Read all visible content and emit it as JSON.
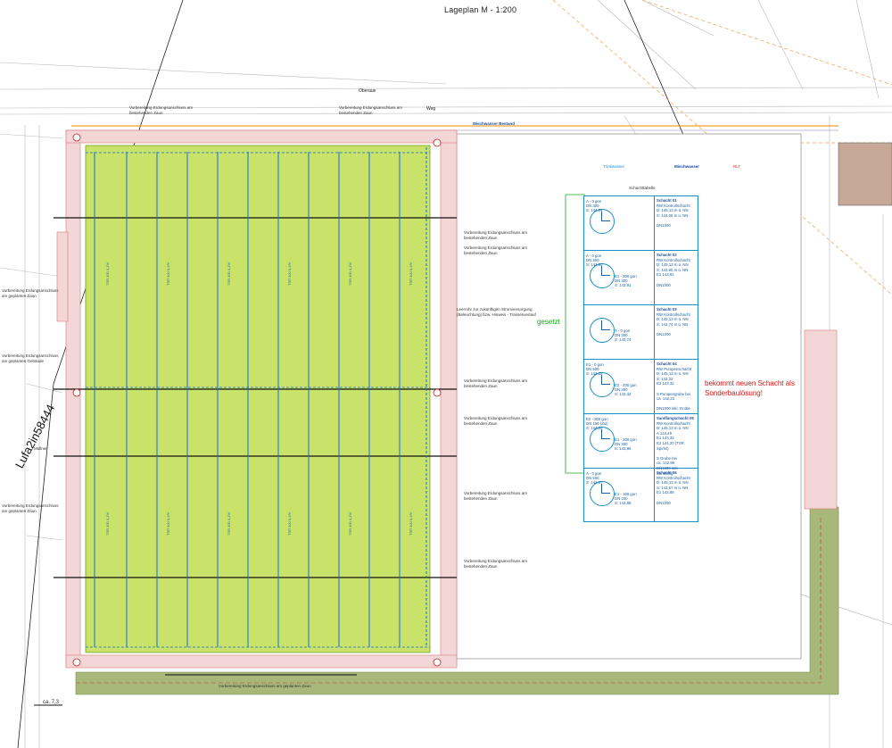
{
  "title": "Lageplan M - 1:200",
  "streets": {
    "upper": "Oberaue",
    "lower": "Weg"
  },
  "side_id": "Lufa2in58444",
  "labels": {
    "gesetzt": "gesetzt",
    "red_note": "bekommt neuen Schacht als Sonderbaulösung!",
    "rw_bestand": "Mischwasser Bestand",
    "regenwasser": "Trinkwasser",
    "mischwasser": "Mischwasser",
    "rlt": "RLT",
    "muellner": "Müllner",
    "dim": "ca. 7,3",
    "schaechte_title": "Schachttabelle"
  },
  "notes": {
    "top_left": "Vorbereitung Erdungsanschluss am bestehenden Zaun",
    "top_mid": "Vorbereitung Erdungsanschluss am bestehenden Zaun",
    "left_1": "Vorbereitung Erdungsanschluss am geplanten Zaun",
    "left_2": "Vorbereitung Erdungsanschluss am geplanten Gebäude",
    "left_3": "Vorbereitung Erdungsanschluss am geplanten Zaun",
    "right_1": "Vorbereitung Erdungsanschluss am bestehenden Zaun",
    "right_2": "Vorbereitung Erdungsanschluss am bestehenden Zaun",
    "right_3": "Leerrohr zur zukünftigen Stromversorgung (Beleuchtung) bzw. Hinweis - Trassenverlauf",
    "right_4": "Vorbereitung Erdungsanschluss am bestehenden Zaun",
    "right_5": "Vorbereitung Erdungsanschluss am bestehenden Zaun",
    "right_6": "Vorbereitung Erdungsanschluss am bestehenden Zaun",
    "right_7": "Vorbereitung Erdungsanschluss am bestehenden Zaun",
    "right_8": "Vorbereitung Erdungsanschluss am bestehenden Zaun",
    "bottom": "Vorbereitung Erdungsanschluss am geplanten Zaun"
  },
  "pipe_label": "TSR 300 0,1%",
  "shafts": [
    {
      "name": "Schacht 01",
      "type": "RW Kontrollschacht",
      "inflow": "A - 0 gon\nDN 300\nS: 144,06",
      "outflow": "",
      "details": [
        "D: 145,13 m ü. NN",
        "S: 144,06 m ü. NN",
        "",
        "DN1000"
      ]
    },
    {
      "name": "Schacht 02",
      "type": "RW Kontrollschacht",
      "inflow": "A - 0 gon\nDN 300\nS: 143,90",
      "outflow": "E1 - 200 gon\nDN 300\nS: 143,91",
      "details": [
        "D: 145,13 m ü. NN",
        "S: 143,90 m ü. NN",
        "E1 143,91",
        "",
        "DN1000"
      ]
    },
    {
      "name": "Schacht 03",
      "type": "RW Kontrollschacht",
      "inflow": "",
      "outflow": "A - 0 gon\nDN 300\nS: 143,74",
      "details": [
        "D: 145,13 m ü. NN",
        "S: 143,74 m ü. NN",
        "",
        "DN1000"
      ]
    },
    {
      "name": "Schacht 04",
      "type": "RW Pumpenschacht",
      "inflow": "E1 - 0 gon\nDN 500\nS: 143,32",
      "outflow": "E2 - 200 gon\nDN 300\nS: 143,32",
      "details": [
        "D: 145,13 m ü. NN",
        "S: 143,32",
        "E2 143,32",
        "",
        "S Pumpengrube bei",
        "ca. 142,23",
        "",
        "DN1000 inkl. Grube"
      ]
    },
    {
      "name": "Sandfangschacht 05",
      "type": "RW Kontrollschacht",
      "inflow": "E2 - 300 gon\nDN 150 (Zul)\nS: 144,00",
      "outflow": "E1 - 200 gon\nDN 300\nS: 143,86",
      "details": [
        "D: 145,13 m ü. NN",
        "A 143,49",
        "E1 143,32",
        "E2 144,20 (TSR Spirlet)",
        "",
        "S Grube bei",
        "ca. 142,99",
        "DN1000 inkl. Sandfang"
      ]
    },
    {
      "name": "Schacht 06",
      "type": "RW Kontrollschacht",
      "inflow": "A - 0 gon\nDN 500\nS: 143,67",
      "outflow": "E1 - 100 gon\nDN 150\nS: 143,88",
      "details": [
        "D: 145,13 m ü. NN",
        "S: 143,67 m ü. NN",
        "E1 143,88",
        "",
        "DN1000"
      ]
    }
  ],
  "colors": {
    "field": "#c8e26a",
    "pipe": "#1a6fd0",
    "fence": "#e0a0a0",
    "path": "#a8b87a",
    "shaft_border": "#1a8fc8",
    "red_text": "#e01010"
  }
}
